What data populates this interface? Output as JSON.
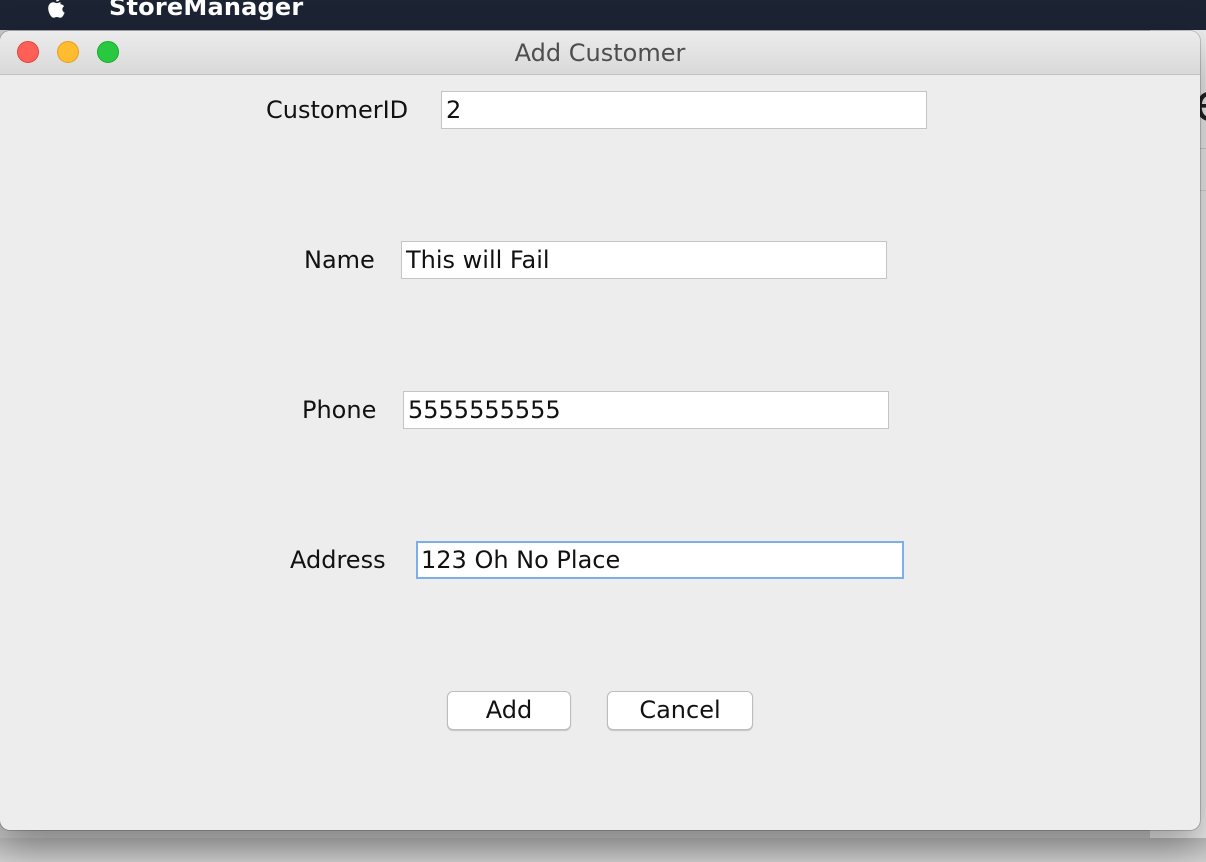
{
  "menubar": {
    "app_name": "StoreManager",
    "apple_icon": "apple-logo-icon"
  },
  "window": {
    "title": "Add Customer",
    "controls": {
      "close_color": "#fe5f57",
      "minimize_color": "#febc2e",
      "maximize_color": "#28c840"
    }
  },
  "form": {
    "customer_id": {
      "label": "CustomerID",
      "value": "2"
    },
    "name": {
      "label": "Name",
      "value": "This will Fail"
    },
    "phone": {
      "label": "Phone",
      "value": "5555555555"
    },
    "address": {
      "label": "Address",
      "value": "123 Oh No Place",
      "focused": true
    }
  },
  "buttons": {
    "add_label": "Add",
    "cancel_label": "Cancel"
  },
  "background_window": {
    "visible_glyph": "e"
  },
  "colors": {
    "menubar": "#1c2333",
    "dialog_bg": "#ededed",
    "focus_ring": "#7eaee8"
  }
}
